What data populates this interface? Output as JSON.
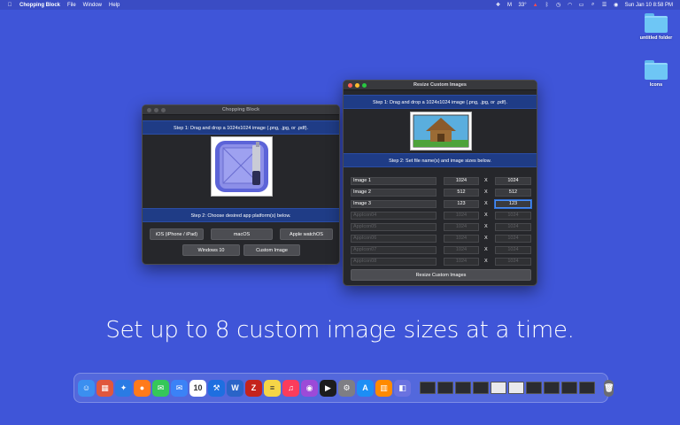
{
  "menubar": {
    "app_name": "Chopping Block",
    "menus": [
      "File",
      "Window",
      "Help"
    ],
    "weather": "33°",
    "datetime": "Sun Jan 10  8:58 PM"
  },
  "desktop": {
    "items": [
      {
        "label": "untitled folder",
        "icon": "folder-icon"
      },
      {
        "label": "Icons",
        "icon": "folder-icon"
      }
    ]
  },
  "main_window": {
    "title": "Chopping Block",
    "step1": "Step 1: Drag and drop a 1024x1024 image (.png, .jpg, or .pdf).",
    "step2": "Step 2: Choose desired app platform(s) below.",
    "buttons": {
      "ios": "iOS (iPhone / iPad)",
      "macos": "macOS",
      "watchos": "Apple watchOS",
      "windows": "Windows 10",
      "custom": "Custom Image"
    }
  },
  "resize_window": {
    "title": "Resize Custom Images",
    "step1": "Step 1: Drag and drop a 1024x1024 image (.png, .jpg, or .pdf).",
    "step2": "Step 2: Set file name(s) and image sizes below.",
    "times": "X",
    "rows": [
      {
        "name": "Image 1",
        "width": "1024",
        "height": "1024",
        "enabled": true
      },
      {
        "name": "Image 2",
        "width": "512",
        "height": "512",
        "enabled": true
      },
      {
        "name": "Image 3",
        "width": "123",
        "height": "123",
        "enabled": true
      },
      {
        "name": "AppIcon04",
        "width": "1024",
        "height": "1024",
        "enabled": false
      },
      {
        "name": "AppIcon05",
        "width": "1024",
        "height": "1024",
        "enabled": false
      },
      {
        "name": "AppIcon06",
        "width": "1024",
        "height": "1024",
        "enabled": false
      },
      {
        "name": "AppIcon07",
        "width": "1024",
        "height": "1024",
        "enabled": false
      },
      {
        "name": "AppIcon08",
        "width": "1024",
        "height": "1024",
        "enabled": false
      }
    ],
    "resize_button": "Resize Custom Images"
  },
  "caption": "Set up to 8 custom image sizes at a time.",
  "dock": {
    "apps": [
      {
        "icon": "finder-icon",
        "color": "#3b8ff0",
        "glyph": "☺"
      },
      {
        "icon": "launchpad-icon",
        "color": "#e0573d",
        "glyph": "▦"
      },
      {
        "icon": "safari-icon",
        "color": "#2a7be4",
        "glyph": "✦"
      },
      {
        "icon": "firefox-icon",
        "color": "#ff7a1a",
        "glyph": "●"
      },
      {
        "icon": "messages-icon",
        "color": "#35c759",
        "glyph": "✉"
      },
      {
        "icon": "mail-icon",
        "color": "#3b82f6",
        "glyph": "✉"
      },
      {
        "icon": "calendar-icon",
        "color": "#ffffff",
        "glyph": "10"
      },
      {
        "icon": "xcode-icon",
        "color": "#1e6fe0",
        "glyph": "⚒"
      },
      {
        "icon": "word-icon",
        "color": "#2a64c8",
        "glyph": "W"
      },
      {
        "icon": "filezilla-icon",
        "color": "#c4231c",
        "glyph": "Z"
      },
      {
        "icon": "notes-icon",
        "color": "#f5d547",
        "glyph": "≡"
      },
      {
        "icon": "music-icon",
        "color": "#fb3c5c",
        "glyph": "♫"
      },
      {
        "icon": "podcasts-icon",
        "color": "#9c4ad8",
        "glyph": "◉"
      },
      {
        "icon": "tv-icon",
        "color": "#1c1c1e",
        "glyph": "▶"
      },
      {
        "icon": "system-preferences-icon",
        "color": "#7e7e84",
        "glyph": "⚙"
      },
      {
        "icon": "app-store-icon",
        "color": "#1c8ef5",
        "glyph": "A"
      },
      {
        "icon": "books-icon",
        "color": "#ff8a00",
        "glyph": "▥"
      },
      {
        "icon": "chopping-block-icon",
        "color": "#6a72e0",
        "glyph": "◧"
      }
    ],
    "thumbs": [
      "dark",
      "dark",
      "dark",
      "dark",
      "light",
      "light",
      "dark",
      "dark",
      "dark",
      "dark"
    ]
  }
}
